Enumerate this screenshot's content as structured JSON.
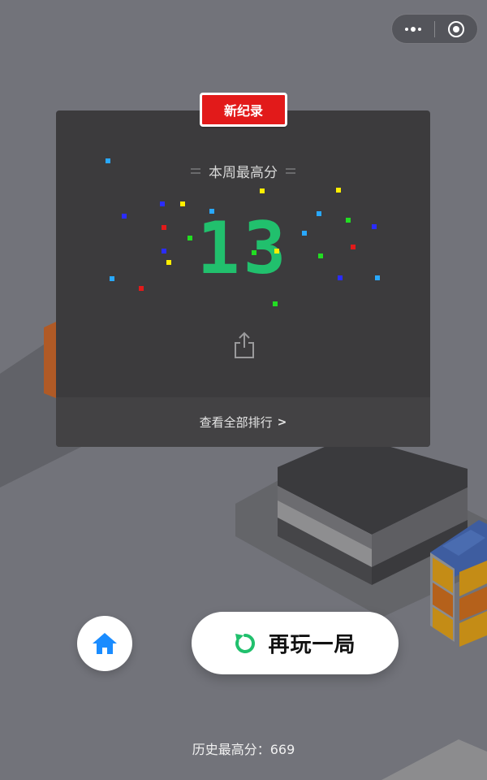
{
  "badge": {
    "label": "新纪录",
    "color": "#e21a1a"
  },
  "card": {
    "title": "本周最高分",
    "score": "13",
    "view_all_label": "查看全部排行",
    "score_color": "#21c06d"
  },
  "icons": {
    "capsule_menu": "more-dots-icon",
    "capsule_close": "close-target-icon",
    "share": "share-icon",
    "home": "home-icon",
    "replay": "replay-icon"
  },
  "buttons": {
    "replay_label": "再玩一局",
    "home_color": "#1a8cff",
    "replay_icon_color": "#21c06d"
  },
  "footer": {
    "history_best": "历史最高分：669"
  }
}
